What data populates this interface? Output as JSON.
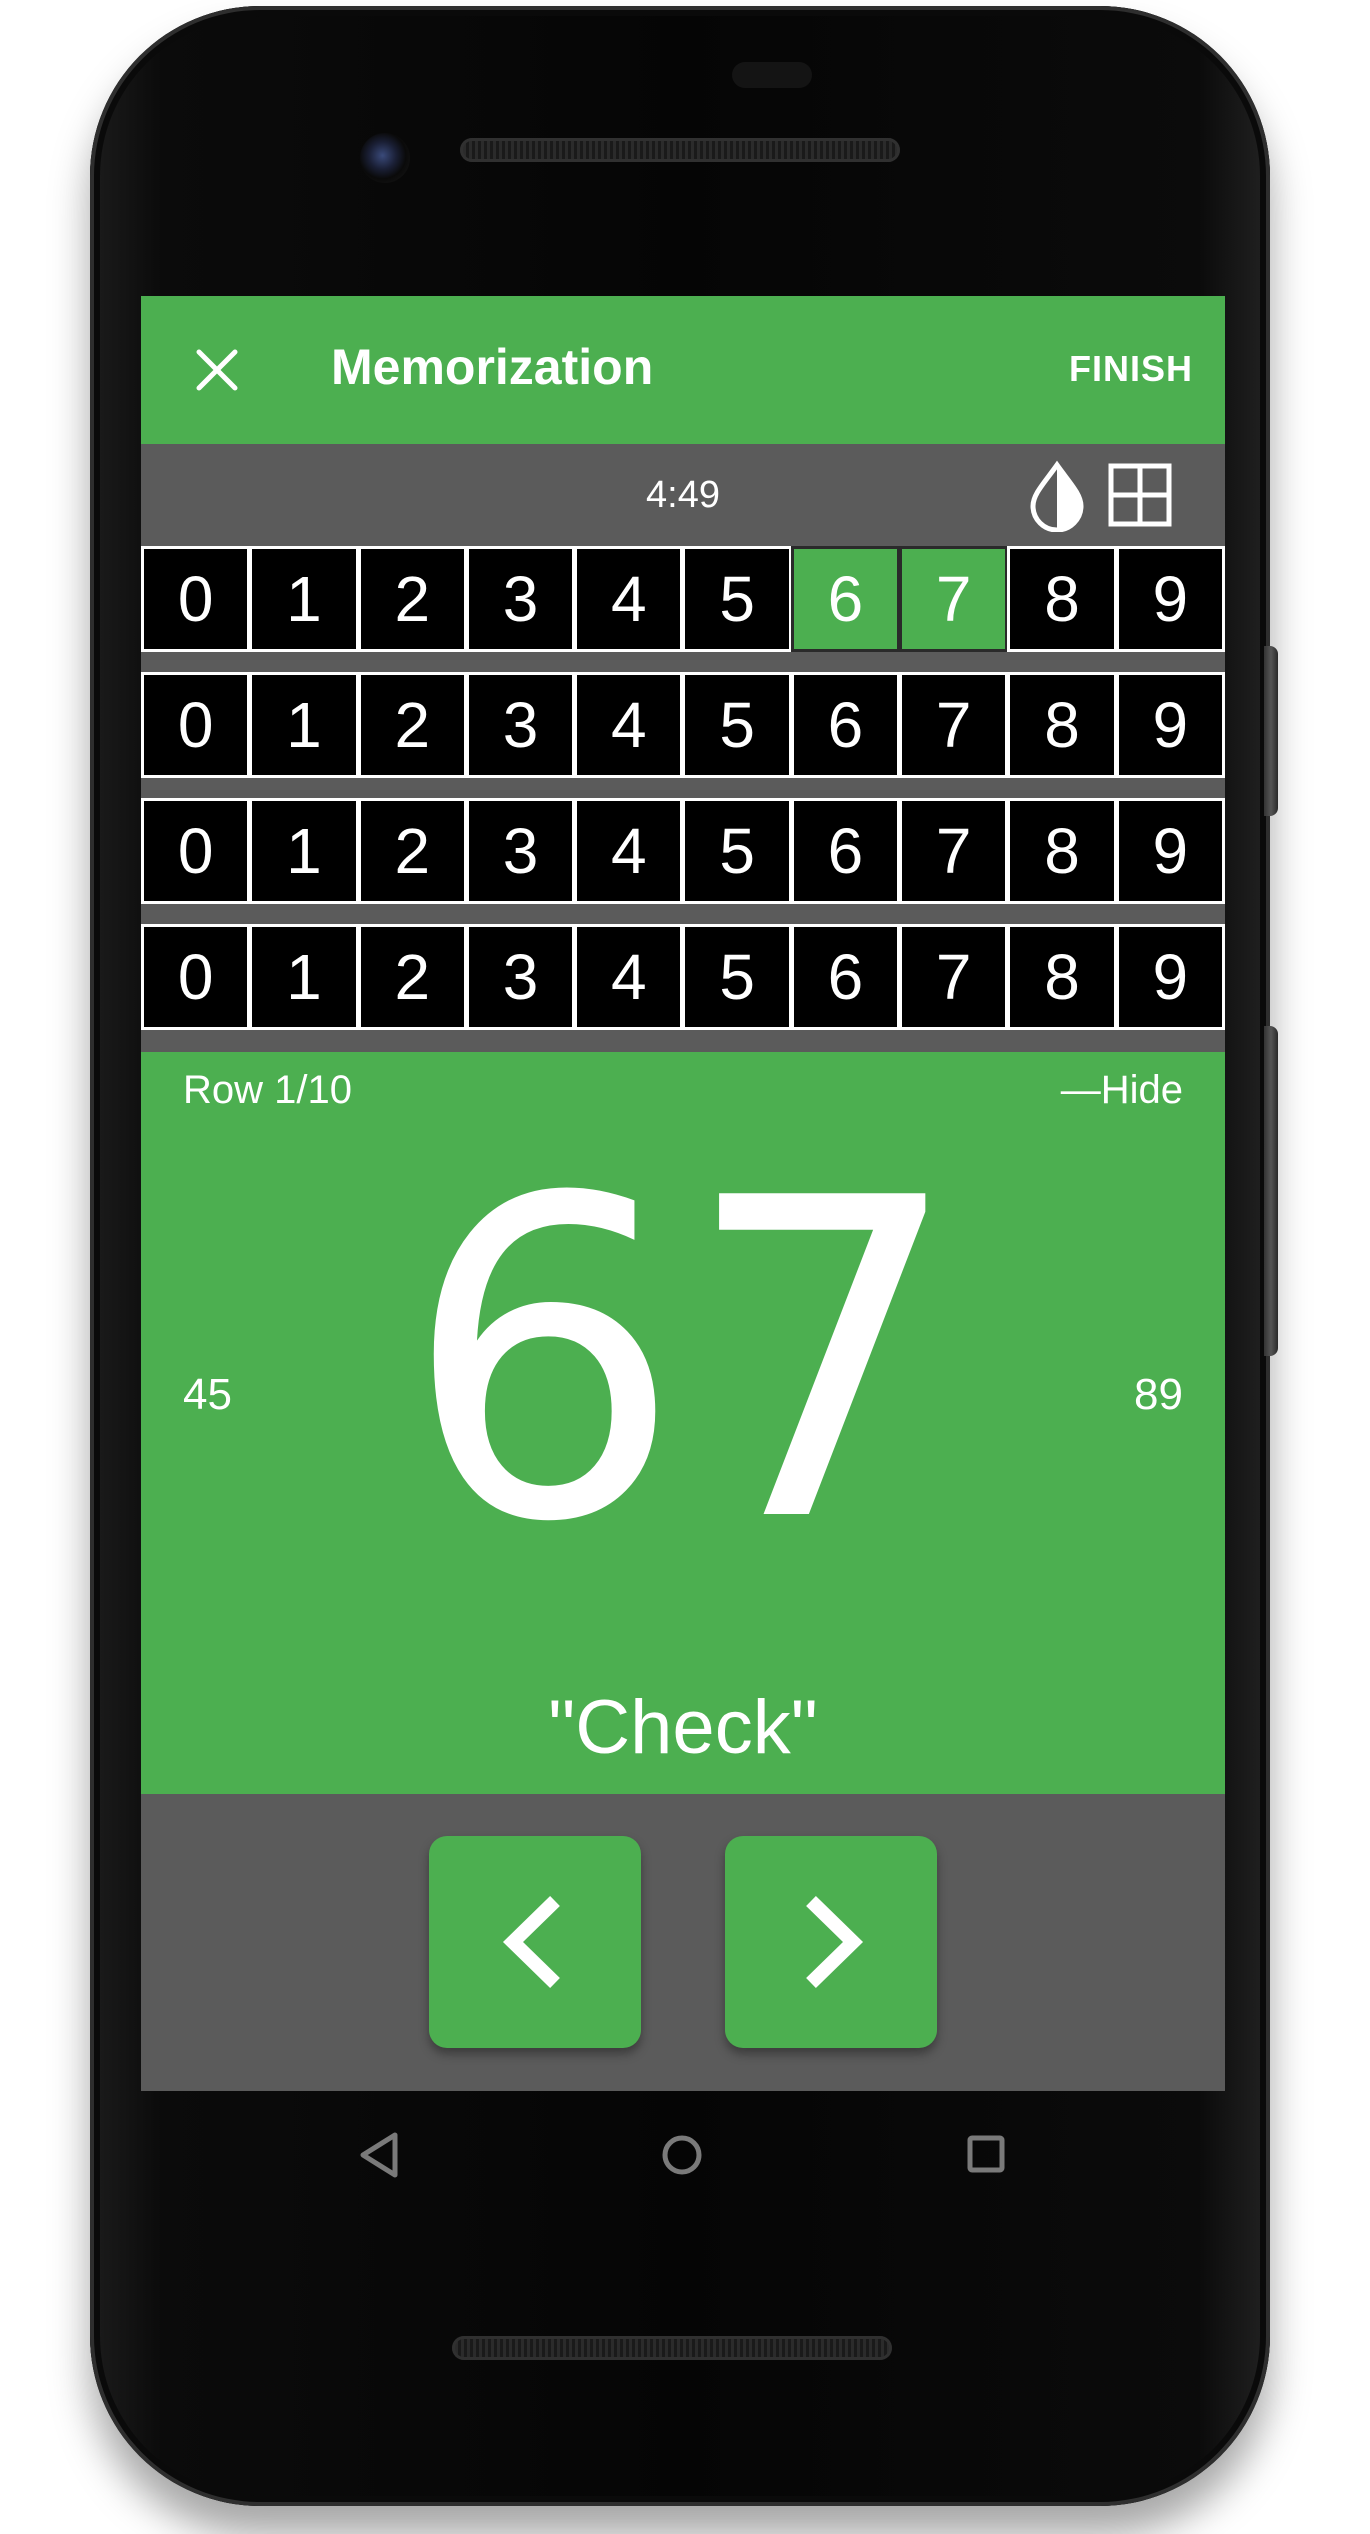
{
  "app_bar": {
    "title": "Memorization",
    "finish_label": "FINISH",
    "close_icon": "close-icon"
  },
  "status": {
    "timer": "4:49",
    "color_mode_icon": "contrast-drop-icon",
    "grid_icon": "grid-view-icon"
  },
  "digit_rows": [
    {
      "digits": [
        "0",
        "1",
        "2",
        "3",
        "4",
        "5",
        "6",
        "7",
        "8",
        "9"
      ],
      "highlighted": [
        6,
        7
      ]
    },
    {
      "digits": [
        "0",
        "1",
        "2",
        "3",
        "4",
        "5",
        "6",
        "7",
        "8",
        "9"
      ],
      "highlighted": []
    },
    {
      "digits": [
        "0",
        "1",
        "2",
        "3",
        "4",
        "5",
        "6",
        "7",
        "8",
        "9"
      ],
      "highlighted": []
    },
    {
      "digits": [
        "0",
        "1",
        "2",
        "3",
        "4",
        "5",
        "6",
        "7",
        "8",
        "9"
      ],
      "highlighted": []
    }
  ],
  "panel": {
    "row_label": "Row 1/10",
    "hide_label": "—Hide",
    "previous_pair": "45",
    "current_pair": "67",
    "next_pair": "89",
    "word": "\"Check\""
  },
  "controls": {
    "prev_icon": "chevron-left-icon",
    "next_icon": "chevron-right-icon"
  },
  "system_nav": {
    "back_icon": "back-triangle-icon",
    "home_icon": "home-circle-icon",
    "recents_icon": "recents-square-icon"
  },
  "colors": {
    "accent_green": "#4caf50",
    "panel_gray": "#5b5b5b",
    "cell_black": "#000000",
    "text_white": "#ffffff"
  }
}
